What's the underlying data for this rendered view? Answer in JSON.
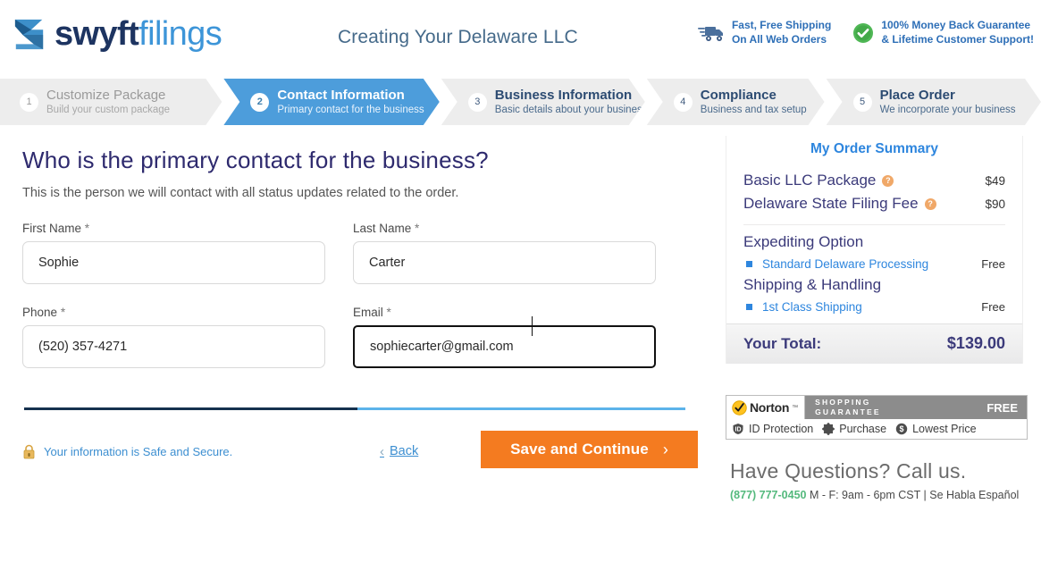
{
  "header": {
    "logo": {
      "part1": "swyft",
      "part2": "filings",
      "icon": "swyft-logo-mark"
    },
    "page_title": "Creating Your Delaware LLC",
    "badges": [
      {
        "icon": "shipping-truck-icon",
        "line1": "Fast, Free Shipping",
        "line2": "On All Web Orders"
      },
      {
        "icon": "green-check-badge-icon",
        "line1": "100% Money Back Guarantee",
        "line2": "& Lifetime Customer Support!"
      }
    ]
  },
  "steps": [
    {
      "num": "1",
      "title": "Customize Package",
      "sub": "Build your custom package",
      "state": "done"
    },
    {
      "num": "2",
      "title": "Contact Information",
      "sub": "Primary contact for the business",
      "state": "active"
    },
    {
      "num": "3",
      "title": "Business Information",
      "sub": "Basic details about your business",
      "state": "upcoming"
    },
    {
      "num": "4",
      "title": "Compliance",
      "sub": "Business and tax setup",
      "state": "upcoming"
    },
    {
      "num": "5",
      "title": "Place Order",
      "sub": "We incorporate your business",
      "state": "upcoming"
    }
  ],
  "form": {
    "headline": "Who is the primary contact for the business?",
    "subhead": "This is the person we will contact with all status updates related to the order.",
    "required_marker": "*",
    "fields": [
      {
        "label": "First Name",
        "value": "Sophie",
        "placeholder": ""
      },
      {
        "label": "Last Name",
        "value": "Carter",
        "placeholder": ""
      },
      {
        "label": "Phone",
        "value": "(520) 357-4271",
        "placeholder": ""
      },
      {
        "label": "Email",
        "value": "sophiecarter@gmail.com",
        "placeholder": ""
      }
    ]
  },
  "actions": {
    "secure_text": "Your information is Safe and Secure.",
    "lock_icon": "padlock-icon",
    "back_label": "Back",
    "back_chevron": "‹",
    "save_label": "Save and Continue",
    "save_chevron": "›"
  },
  "summary": {
    "title": "My Order Summary",
    "items": [
      {
        "name": "Basic LLC Package",
        "price": "$49",
        "help": "?"
      },
      {
        "name": "Delaware State Filing Fee",
        "price": "$90",
        "help": "?"
      }
    ],
    "groups": [
      {
        "heading": "Expediting Option",
        "options": [
          {
            "name": "Standard Delaware Processing",
            "price": "Free"
          }
        ]
      },
      {
        "heading": "Shipping & Handling",
        "options": [
          {
            "name": "1st Class Shipping",
            "price": "Free"
          }
        ]
      }
    ],
    "total_label": "Your Total:",
    "total_value": "$139.00"
  },
  "norton": {
    "brand": "Norton",
    "tm": "™",
    "guarantee_line1": "SHOPPING",
    "guarantee_line2": "GUARANTEE",
    "free": "FREE",
    "items": [
      {
        "icon": "id-protection-icon",
        "label": "ID Protection"
      },
      {
        "icon": "purchase-icon",
        "label": "Purchase"
      },
      {
        "icon": "lowest-price-icon",
        "label": "Lowest Price"
      }
    ]
  },
  "questions": {
    "title": "Have Questions? Call us.",
    "phone": "(877) 777-0450",
    "hours": " M - F: 9am - 6pm CST | Se Habla Español"
  }
}
